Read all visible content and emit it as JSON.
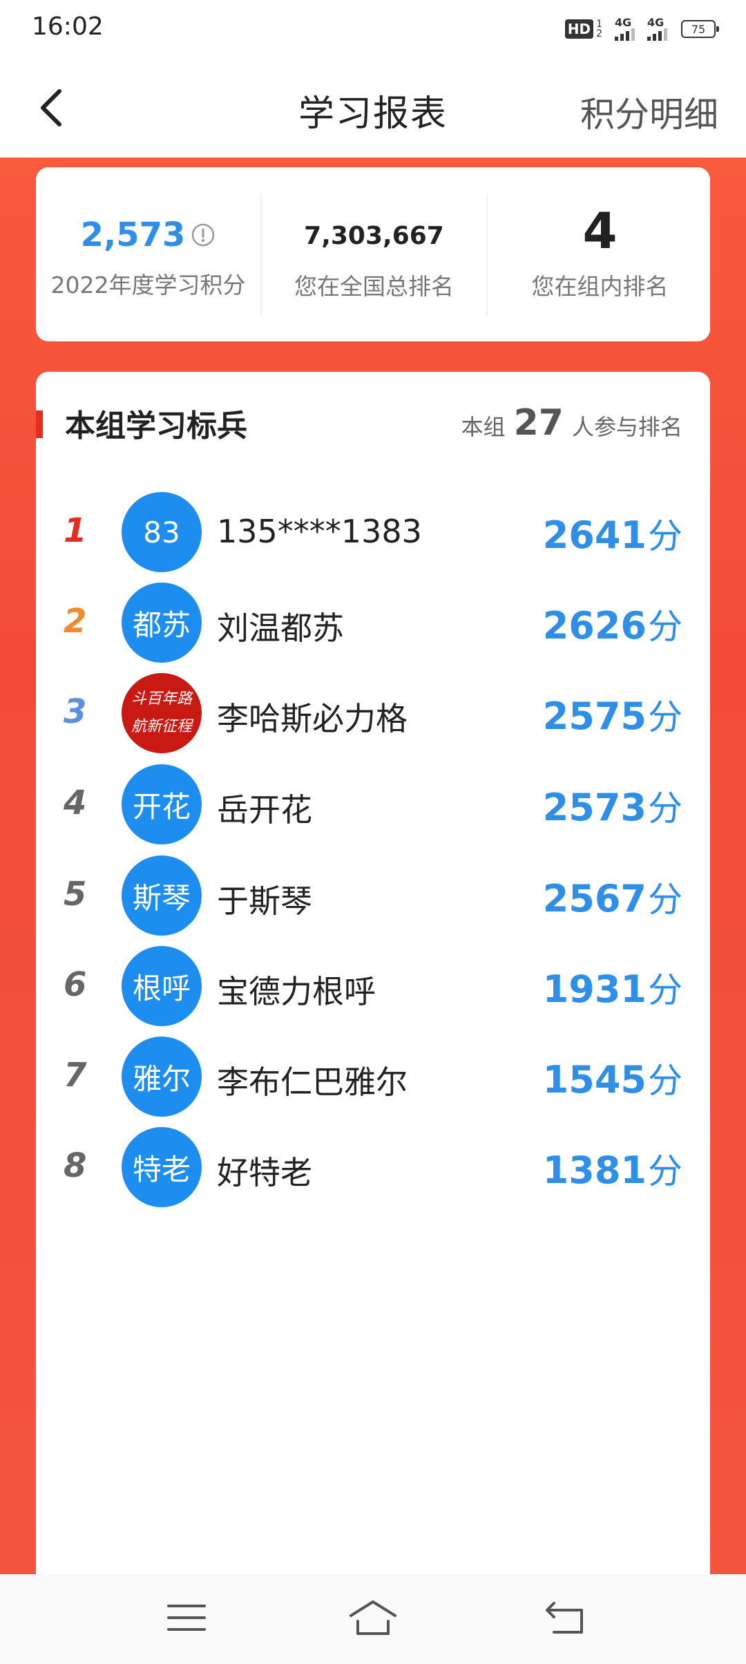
{
  "status_bar": {
    "time": "16:02",
    "hd_label": "HD",
    "hd_sub_top": "1",
    "hd_sub_bottom": "2",
    "signal1_label": "4G",
    "signal2_label": "4G",
    "battery": "75"
  },
  "header": {
    "title": "学习报表",
    "right_link": "积分明细"
  },
  "stats": {
    "points_value": "2,573",
    "points_label": "2022年度学习积分",
    "national_rank_value": "7,303,667",
    "national_rank_label": "您在全国总排名",
    "group_rank_value": "4",
    "group_rank_label": "您在组内排名"
  },
  "board": {
    "title": "本组学习标兵",
    "meta_prefix": "本组",
    "participant_count": "27",
    "meta_suffix": "人参与排名",
    "rows": [
      {
        "rank": "1",
        "avatar_text": "83",
        "name": "135****1383",
        "score": "2641",
        "unit": "分"
      },
      {
        "rank": "2",
        "avatar_text": "都苏",
        "name": "刘温都苏",
        "score": "2626",
        "unit": "分"
      },
      {
        "rank": "3",
        "avatar_text": "",
        "name": "李哈斯必力格",
        "score": "2575",
        "unit": "分"
      },
      {
        "rank": "4",
        "avatar_text": "开花",
        "name": "岳开花",
        "score": "2573",
        "unit": "分"
      },
      {
        "rank": "5",
        "avatar_text": "斯琴",
        "name": "于斯琴",
        "score": "2567",
        "unit": "分"
      },
      {
        "rank": "6",
        "avatar_text": "根呼",
        "name": "宝德力根呼",
        "score": "1931",
        "unit": "分"
      },
      {
        "rank": "7",
        "avatar_text": "雅尔",
        "name": "李布仁巴雅尔",
        "score": "1545",
        "unit": "分"
      },
      {
        "rank": "8",
        "avatar_text": "特老",
        "name": "好特老",
        "score": "1381",
        "unit": "分"
      }
    ]
  },
  "avatar_image_text": "奋斗百年路 启航新征程",
  "colors": {
    "accent_red": "#e82a1f",
    "score_blue": "#2f8ee6",
    "avatar_blue": "#1d8ef0",
    "rank1": "#e82a1f",
    "rank2": "#f08a2c",
    "rank3": "#5b8fe0",
    "rank_default": "#666666"
  },
  "icons": {
    "back": "chevron-left-icon",
    "info": "info-icon",
    "nav_menu": "menu-icon",
    "nav_home": "home-icon",
    "nav_back": "return-icon"
  }
}
